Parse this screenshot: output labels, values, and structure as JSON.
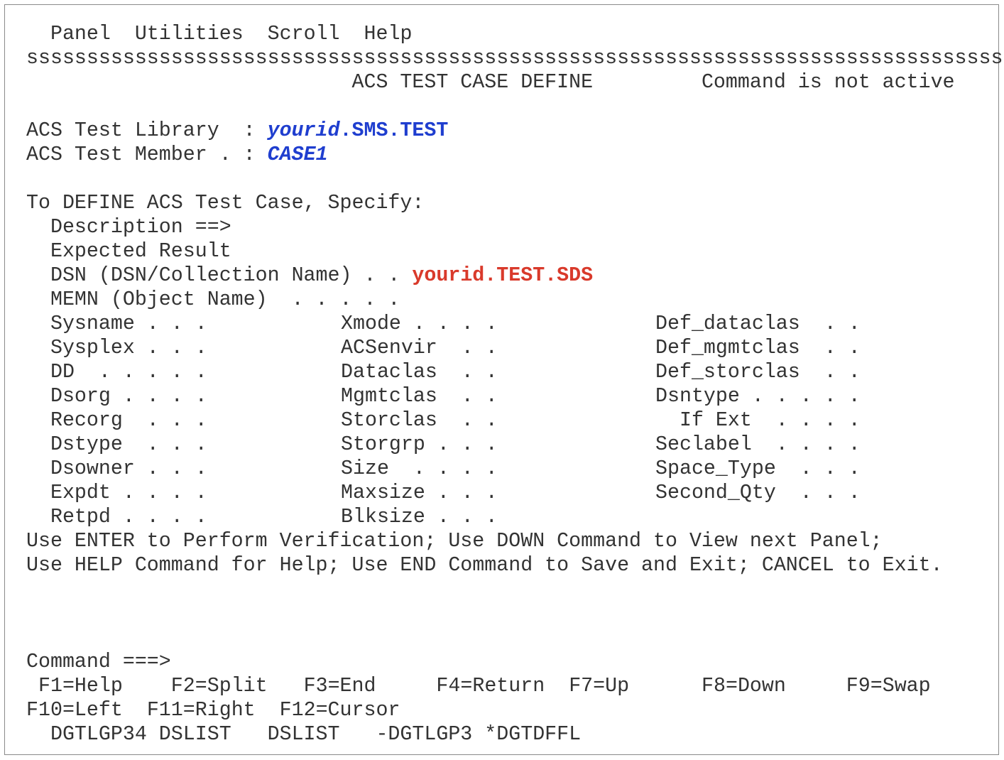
{
  "menu_bar": [
    "Panel",
    "Utilities",
    "Scroll",
    "Help"
  ],
  "separator": "ssssssssssssssssssssssssssssssssssssssssssssssssssssssssssssssssssssssssssssssssss",
  "header": {
    "title": "ACS TEST CASE DEFINE",
    "status": "Command is not active"
  },
  "library": {
    "label": "ACS Test Library  : ",
    "value_italic": "yourid",
    "value_rest": ".SMS.TEST"
  },
  "member": {
    "label": "ACS Test Member . : ",
    "value": "CASE1"
  },
  "instructions": "To DEFINE ACS Test Case, Specify:",
  "description": "  Description ==>",
  "expected_result": "  Expected Result",
  "dsn": {
    "label": "  DSN (DSN/Collection Name) . . ",
    "value": "yourid.TEST.SDS"
  },
  "memn": "  MEMN (Object Name)  . . . . .",
  "fields_rows": [
    [
      "  Sysname . . .",
      "Xmode . . . .",
      "Def_dataclas  . ."
    ],
    [
      "  Sysplex . . .",
      "ACSenvir  . .",
      "Def_mgmtclas  . ."
    ],
    [
      "  DD  . . . . .",
      "Dataclas  . .",
      "Def_storclas  . ."
    ],
    [
      "  Dsorg . . . .",
      "Mgmtclas  . .",
      "Dsntype . . . . ."
    ],
    [
      "  Recorg  . . .",
      "Storclas  . .",
      "  If Ext  . . . ."
    ],
    [
      "  Dstype  . . .",
      "Storgrp . . .",
      "Seclabel  . . . ."
    ],
    [
      "  Dsowner . . .",
      "Size  . . . .",
      "Space_Type  . . ."
    ],
    [
      "  Expdt . . . .",
      "Maxsize . . .",
      "Second_Qty  . . ."
    ],
    [
      "  Retpd . . . .",
      "Blksize . . .",
      ""
    ]
  ],
  "help_lines": [
    "Use ENTER to Perform Verification; Use DOWN Command to View next Panel;",
    "Use HELP Command for Help; Use END Command to Save and Exit; CANCEL to Exit."
  ],
  "command_prompt": "Command ===>",
  "fkeys_row1": [
    " F1=Help",
    "F2=Split",
    "F3=End",
    "F4=Return",
    "F7=Up",
    "F8=Down",
    "F9=Swap"
  ],
  "fkeys_row2": [
    "F10=Left",
    "F11=Right",
    "F12=Cursor"
  ],
  "session_tabs": "  DGTLGP34 DSLIST   DSLIST   -DGTLGP3 *DGTDFFL",
  "colors": {
    "field_value_blue": "#1f3ecf",
    "field_value_red": "#d93a2b",
    "text": "#333333"
  }
}
